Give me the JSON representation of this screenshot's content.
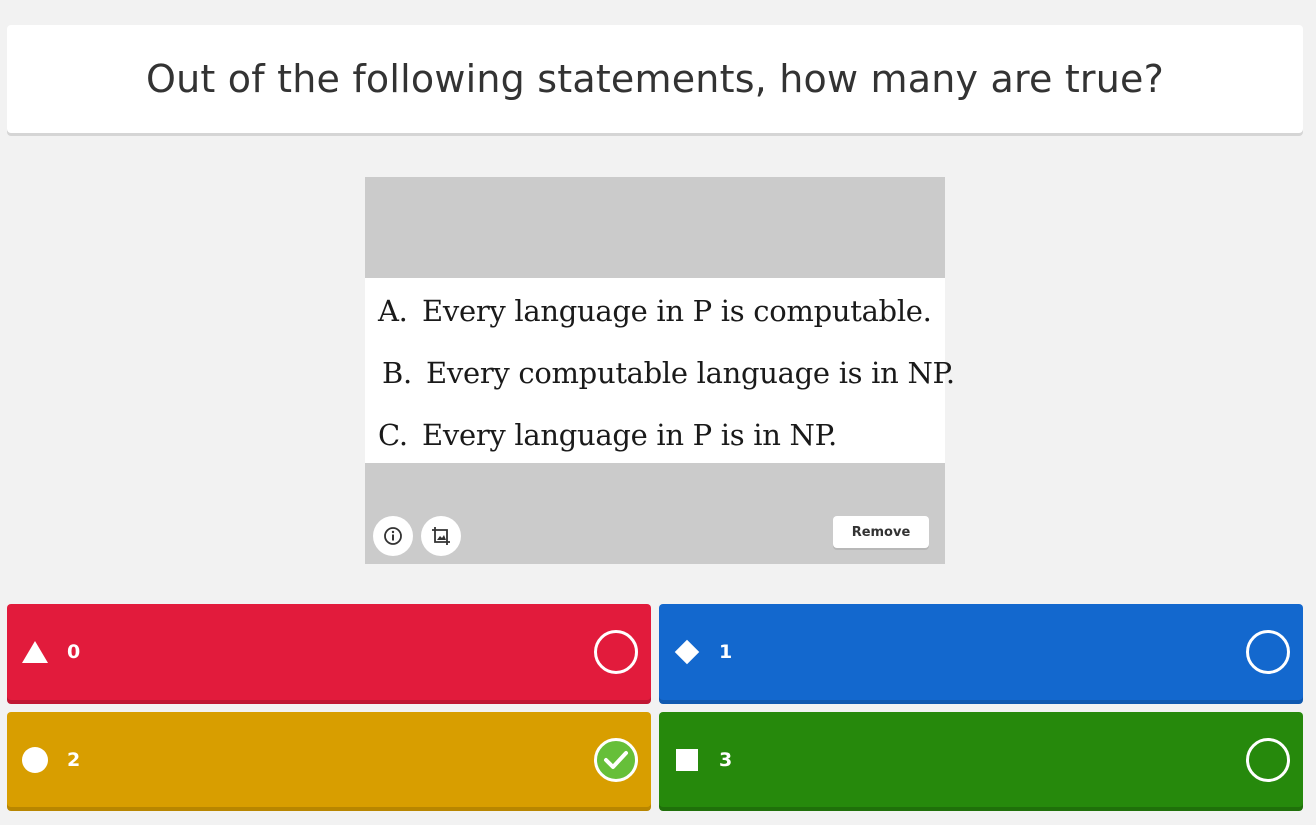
{
  "question": {
    "title": "Out of the following statements, how many are true?"
  },
  "media": {
    "statements": [
      {
        "letter": "A.",
        "text": "Every language in P is computable."
      },
      {
        "letter": "B.",
        "text": "Every computable language is in NP."
      },
      {
        "letter": "C.",
        "text": "Every language in P is in NP."
      }
    ],
    "info_icon": "info-icon",
    "crop_icon": "crop-image-icon",
    "remove_label": "Remove"
  },
  "answers": [
    {
      "label": "0",
      "shape": "triangle-icon",
      "color": "#e21b3c",
      "correct": false
    },
    {
      "label": "1",
      "shape": "diamond-icon",
      "color": "#1368ce",
      "correct": false
    },
    {
      "label": "2",
      "shape": "circle-icon",
      "color": "#d89e00",
      "correct": true
    },
    {
      "label": "3",
      "shape": "square-icon",
      "color": "#26890c",
      "correct": false
    }
  ],
  "colors": {
    "background": "#f2f2f2",
    "correct_check": "#66bf39"
  }
}
